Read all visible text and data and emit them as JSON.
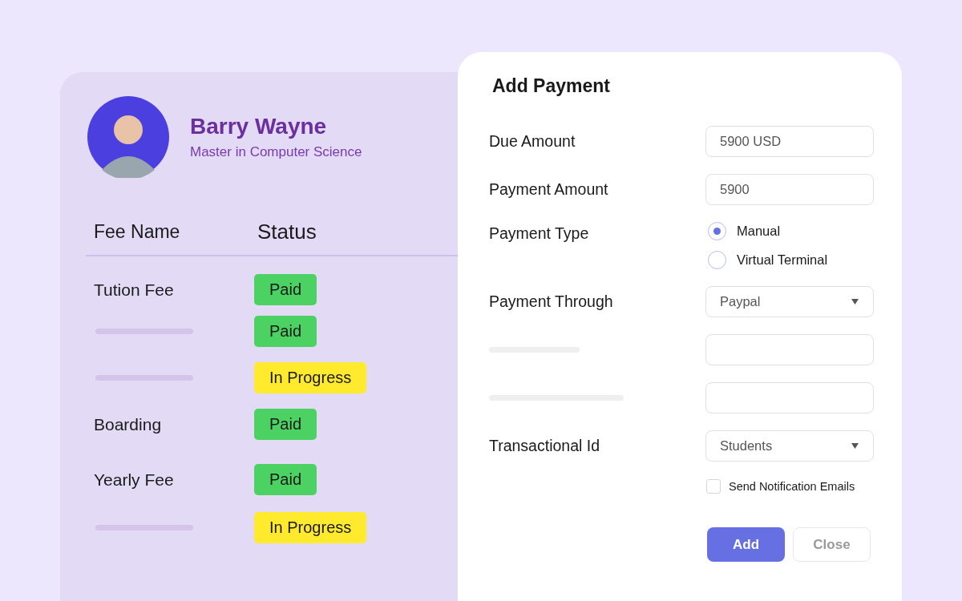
{
  "profile": {
    "name": "Barry Wayne",
    "program": "Master in Computer Science"
  },
  "fees": {
    "columns": [
      "Fee Name",
      "Status"
    ],
    "rows": [
      {
        "name": "Tution Fee",
        "status": "Paid",
        "color": "#4cd263"
      },
      {
        "status": "Paid",
        "color": "#4cd263"
      },
      {
        "status": "In Progress",
        "color": "#ffea2e"
      },
      {
        "name": "Boarding",
        "status": "Paid",
        "color": "#4cd263"
      },
      {
        "name": "Yearly Fee",
        "status": "Paid",
        "color": "#4cd263"
      },
      {
        "status": "In Progress",
        "color": "#ffea2e"
      }
    ]
  },
  "dialog": {
    "title": "Add Payment",
    "fields": [
      {
        "kind": "input",
        "label": "Due Amount",
        "value": "5900 USD"
      },
      {
        "kind": "input",
        "label": "Payment Amount",
        "value": "5900"
      },
      {
        "kind": "radio",
        "label": "Payment Type",
        "options": [
          {
            "label": "Manual",
            "selected": true
          },
          {
            "label": "Virtual Terminal",
            "selected": false
          }
        ]
      },
      {
        "kind": "select",
        "label": "Payment Through",
        "value": "Paypal"
      },
      {
        "kind": "input"
      },
      {
        "kind": "input"
      },
      {
        "kind": "select",
        "label": "Transactional Id",
        "value": "Students"
      },
      {
        "kind": "checkbox",
        "label": "Send Notification Emails",
        "checked": false
      }
    ],
    "buttons": [
      {
        "label": "Add",
        "kind": "primary"
      },
      {
        "label": "Close",
        "kind": "secondary"
      }
    ]
  }
}
